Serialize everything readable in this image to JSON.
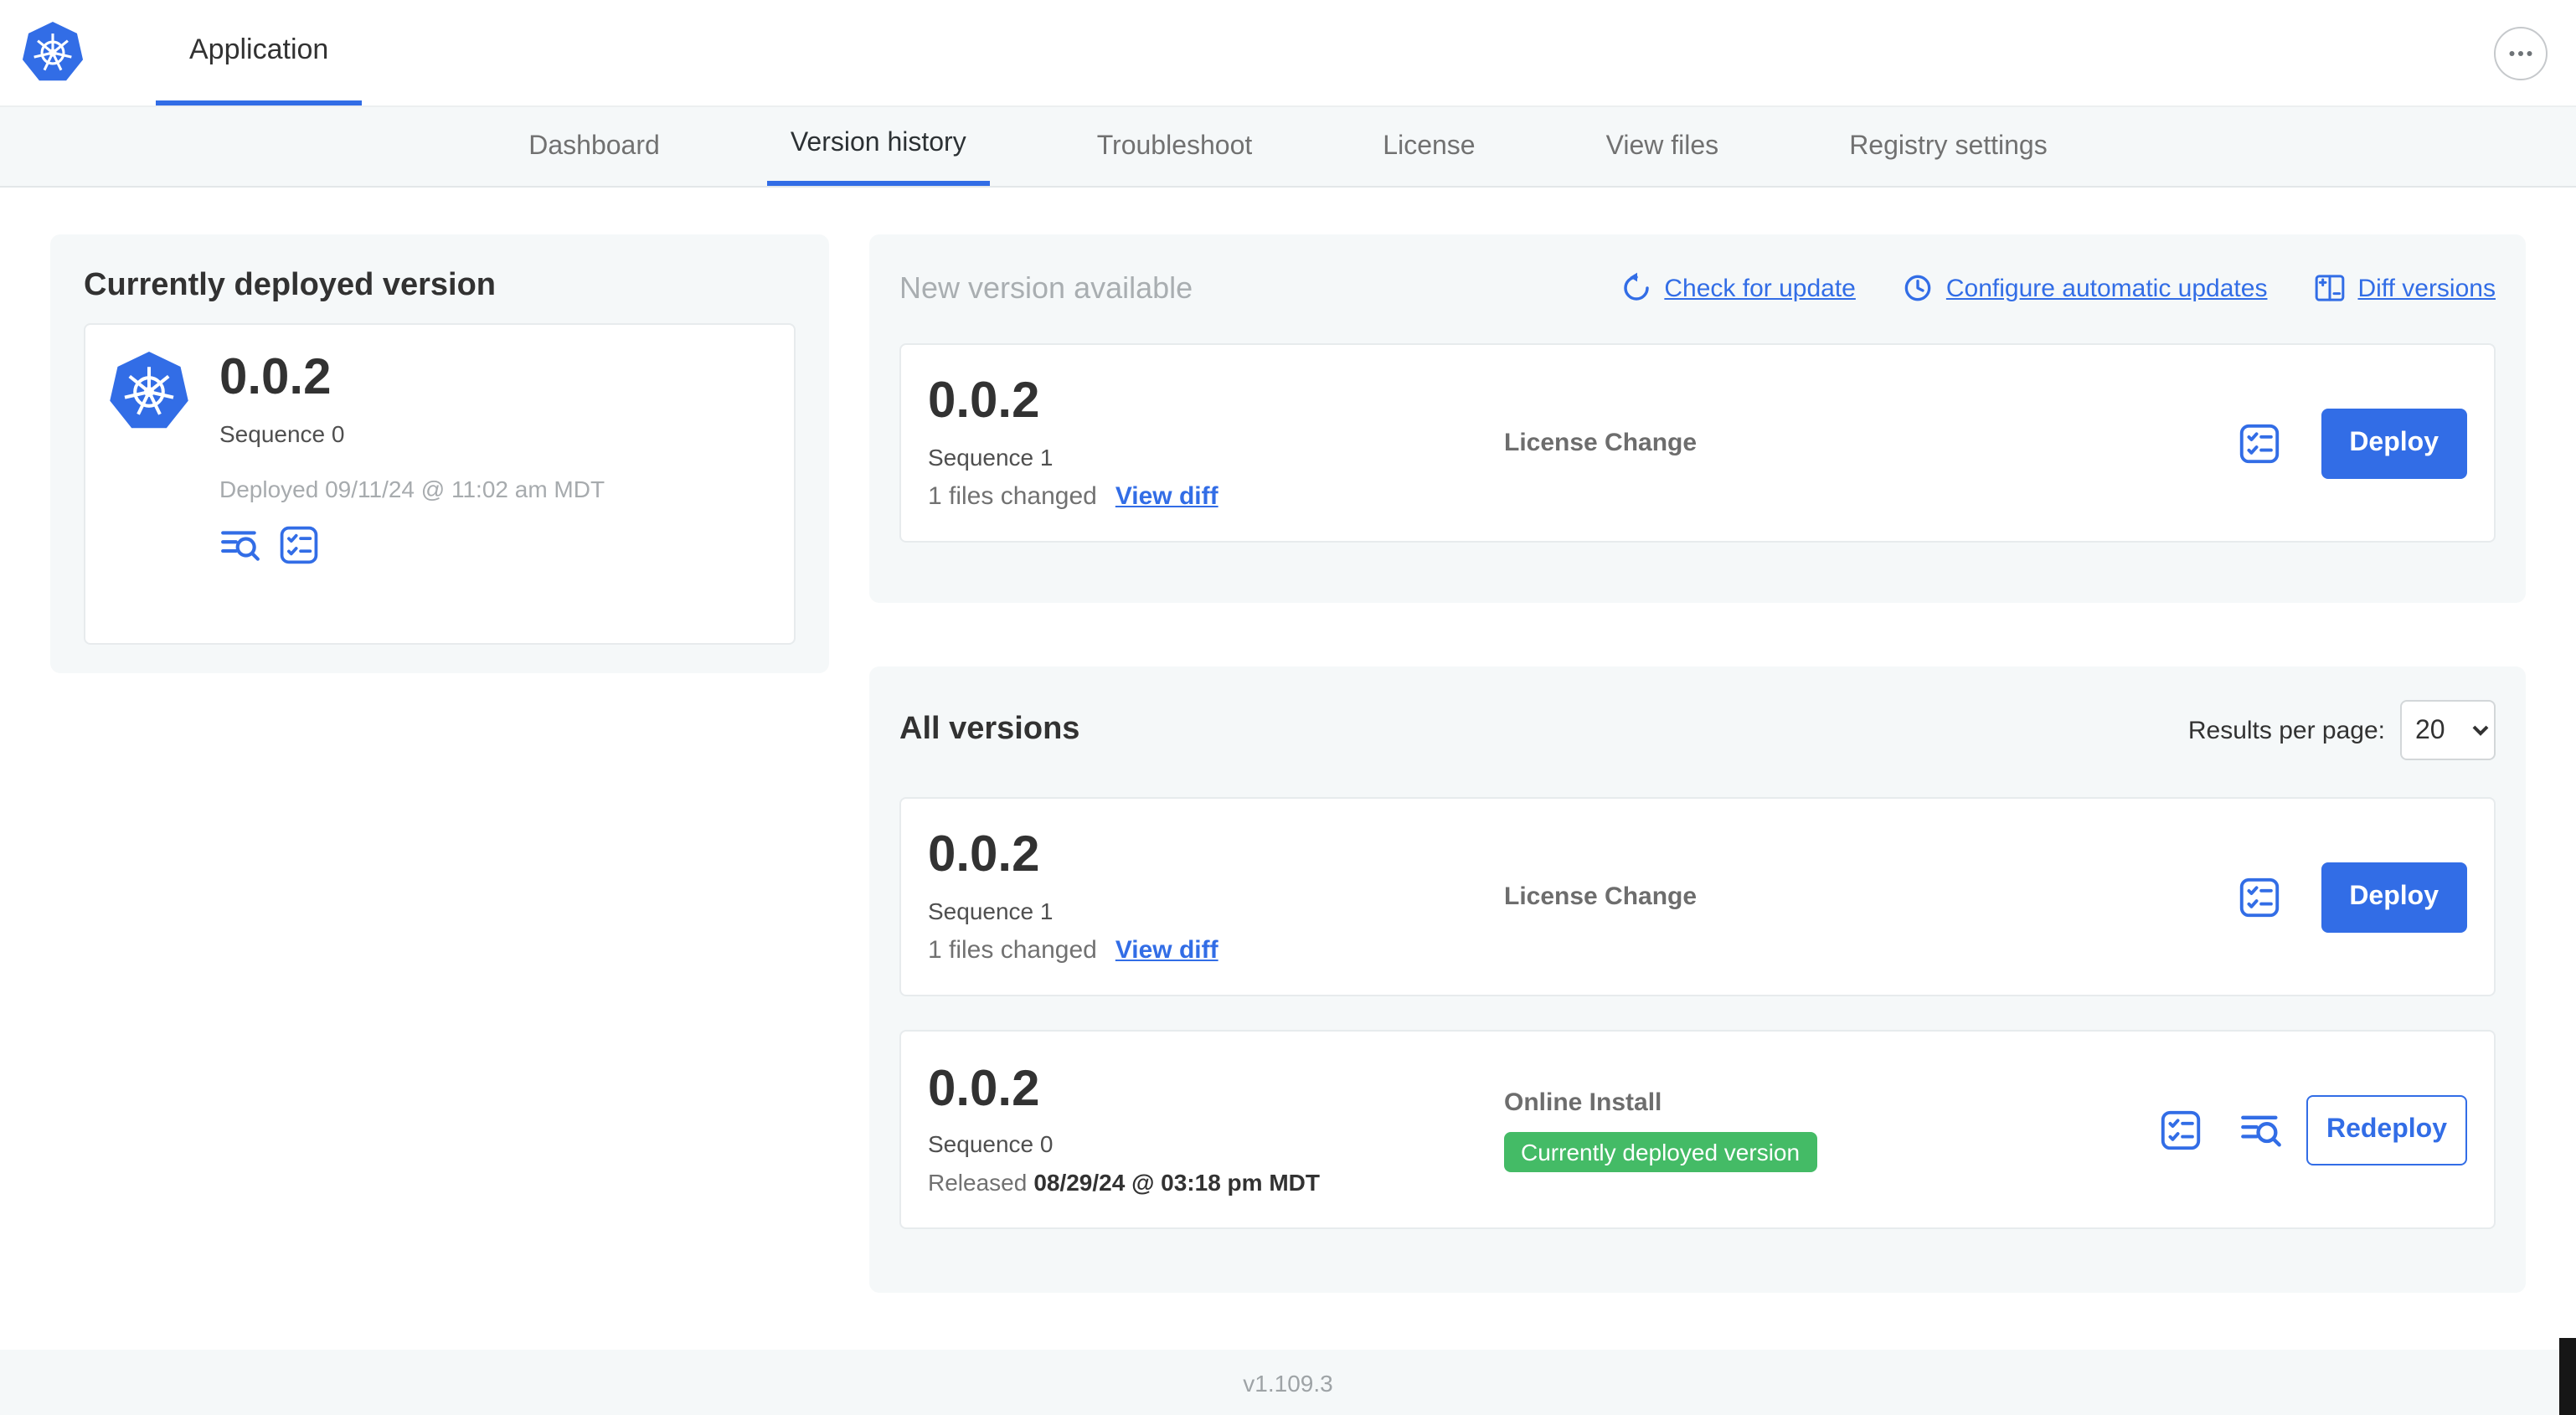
{
  "colors": {
    "accent": "#326de6",
    "badge_green": "#44bb66",
    "panel_bg": "#f5f8f9"
  },
  "icons": {
    "app_logo": "kubernetes-wheel",
    "more": "ellipsis",
    "check_update": "refresh-arrow",
    "auto_update": "clock",
    "diff": "split-table",
    "release_notes": "lines-magnifier",
    "config": "boxed-checklist"
  },
  "topbar": {
    "app_tab": "Application"
  },
  "nav": {
    "items": [
      {
        "label": "Dashboard",
        "active": false
      },
      {
        "label": "Version history",
        "active": true
      },
      {
        "label": "Troubleshoot",
        "active": false
      },
      {
        "label": "License",
        "active": false
      },
      {
        "label": "View files",
        "active": false
      },
      {
        "label": "Registry settings",
        "active": false
      }
    ]
  },
  "current_version": {
    "title": "Currently deployed version",
    "version": "0.0.2",
    "sequence": "Sequence 0",
    "deployed": "Deployed 09/11/24 @ 11:02 am MDT"
  },
  "new_version": {
    "title": "New version available",
    "actions": {
      "check_for_update": "Check for update",
      "configure_automatic_updates": "Configure automatic updates",
      "diff_versions": "Diff versions"
    },
    "entry": {
      "version": "0.0.2",
      "sequence": "Sequence 1",
      "files_changed": "1 files changed",
      "view_diff": "View diff",
      "source": "License Change",
      "deploy_label": "Deploy"
    }
  },
  "all_versions": {
    "title": "All versions",
    "results_per_page_label": "Results per page:",
    "results_per_page_value": "20",
    "rows": [
      {
        "version": "0.0.2",
        "sequence": "Sequence 1",
        "files_changed": "1 files changed",
        "view_diff": "View diff",
        "source": "License Change",
        "action_label": "Deploy"
      },
      {
        "version": "0.0.2",
        "sequence": "Sequence 0",
        "released_prefix": "Released",
        "released_date": "08/29/24 @ 03:18 pm MDT",
        "source": "Online Install",
        "badge": "Currently deployed version",
        "action_label": "Redeploy"
      }
    ]
  },
  "footer": {
    "app_version": "v1.109.3"
  }
}
